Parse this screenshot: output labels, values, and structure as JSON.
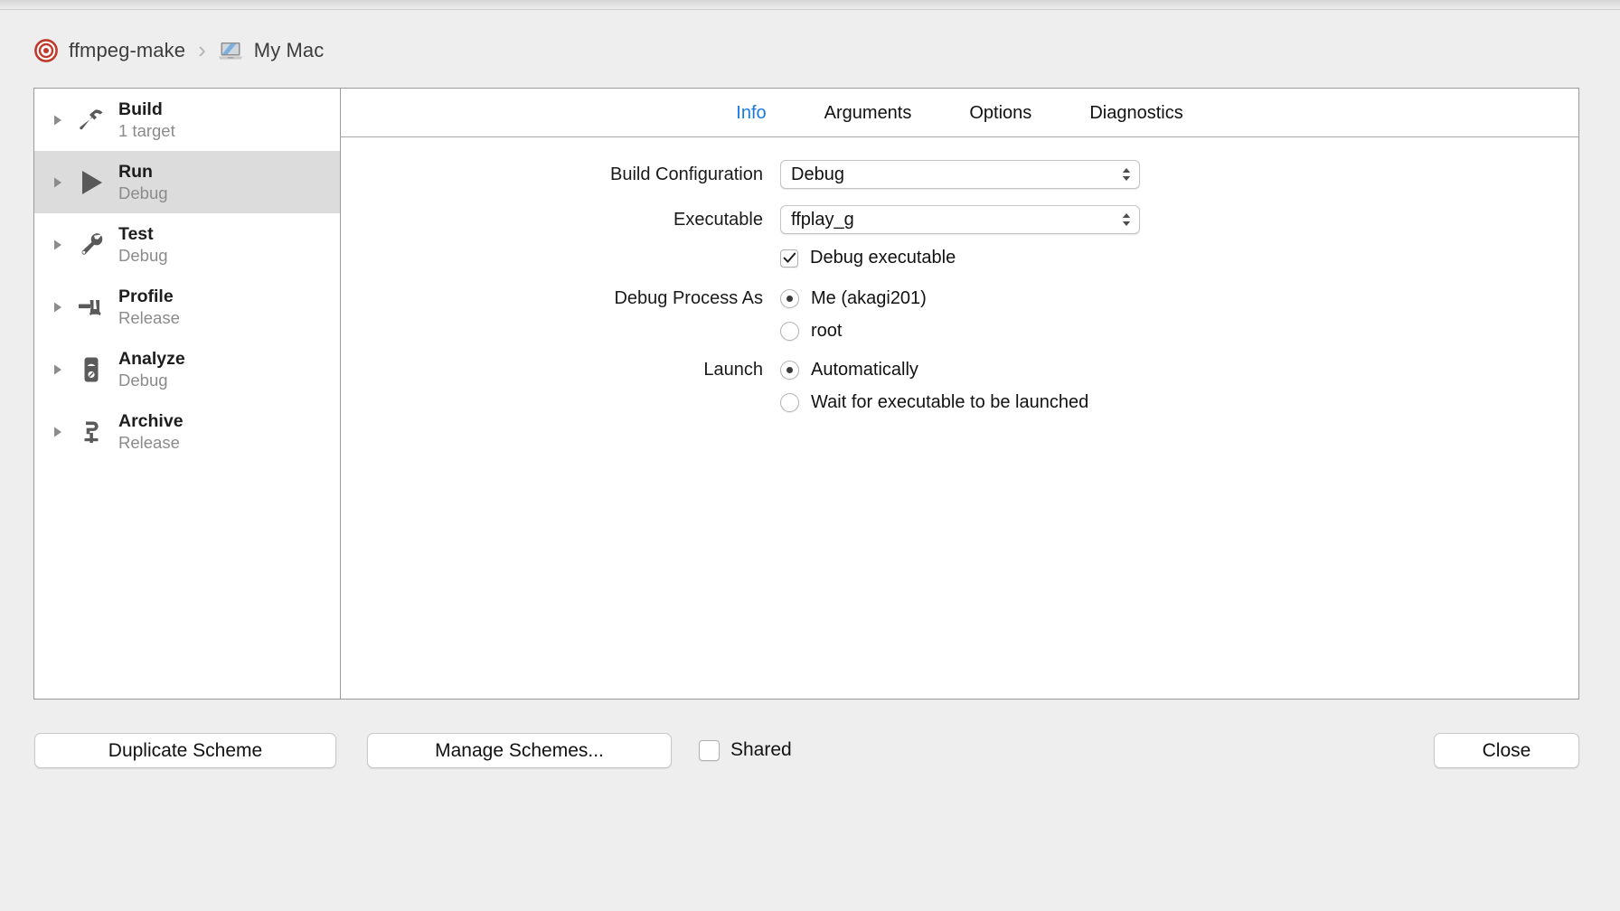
{
  "breadcrumb": {
    "scheme_icon": "target-icon",
    "scheme_name": "ffmpeg-make",
    "separator": "›",
    "destination_icon": "laptop-icon",
    "destination_name": "My Mac"
  },
  "sidebar": {
    "items": [
      {
        "title": "Build",
        "subtitle": "1 target",
        "icon": "hammer-icon",
        "selected": false
      },
      {
        "title": "Run",
        "subtitle": "Debug",
        "icon": "play-icon",
        "selected": true
      },
      {
        "title": "Test",
        "subtitle": "Debug",
        "icon": "wrench-icon",
        "selected": false
      },
      {
        "title": "Profile",
        "subtitle": "Release",
        "icon": "caliper-icon",
        "selected": false
      },
      {
        "title": "Analyze",
        "subtitle": "Debug",
        "icon": "analyze-icon",
        "selected": false
      },
      {
        "title": "Archive",
        "subtitle": "Release",
        "icon": "clamp-icon",
        "selected": false
      }
    ]
  },
  "tabs": [
    {
      "label": "Info",
      "active": true
    },
    {
      "label": "Arguments",
      "active": false
    },
    {
      "label": "Options",
      "active": false
    },
    {
      "label": "Diagnostics",
      "active": false
    }
  ],
  "form": {
    "build_configuration": {
      "label": "Build Configuration",
      "value": "Debug"
    },
    "executable": {
      "label": "Executable",
      "value": "ffplay_g"
    },
    "debug_executable": {
      "label": "Debug executable",
      "checked": true
    },
    "debug_process_as": {
      "label": "Debug Process As",
      "options": [
        {
          "label": "Me (akagi201)",
          "selected": true
        },
        {
          "label": "root",
          "selected": false
        }
      ]
    },
    "launch": {
      "label": "Launch",
      "options": [
        {
          "label": "Automatically",
          "selected": true
        },
        {
          "label": "Wait for executable to be launched",
          "selected": false
        }
      ]
    }
  },
  "footer": {
    "duplicate_scheme": "Duplicate Scheme",
    "manage_schemes": "Manage Schemes...",
    "shared_label": "Shared",
    "shared_checked": false,
    "close": "Close"
  },
  "colors": {
    "accent_blue": "#1779e4",
    "target_red": "#c0392b",
    "selected_row": "#dcdcdc",
    "window_bg": "#eeeeee"
  }
}
